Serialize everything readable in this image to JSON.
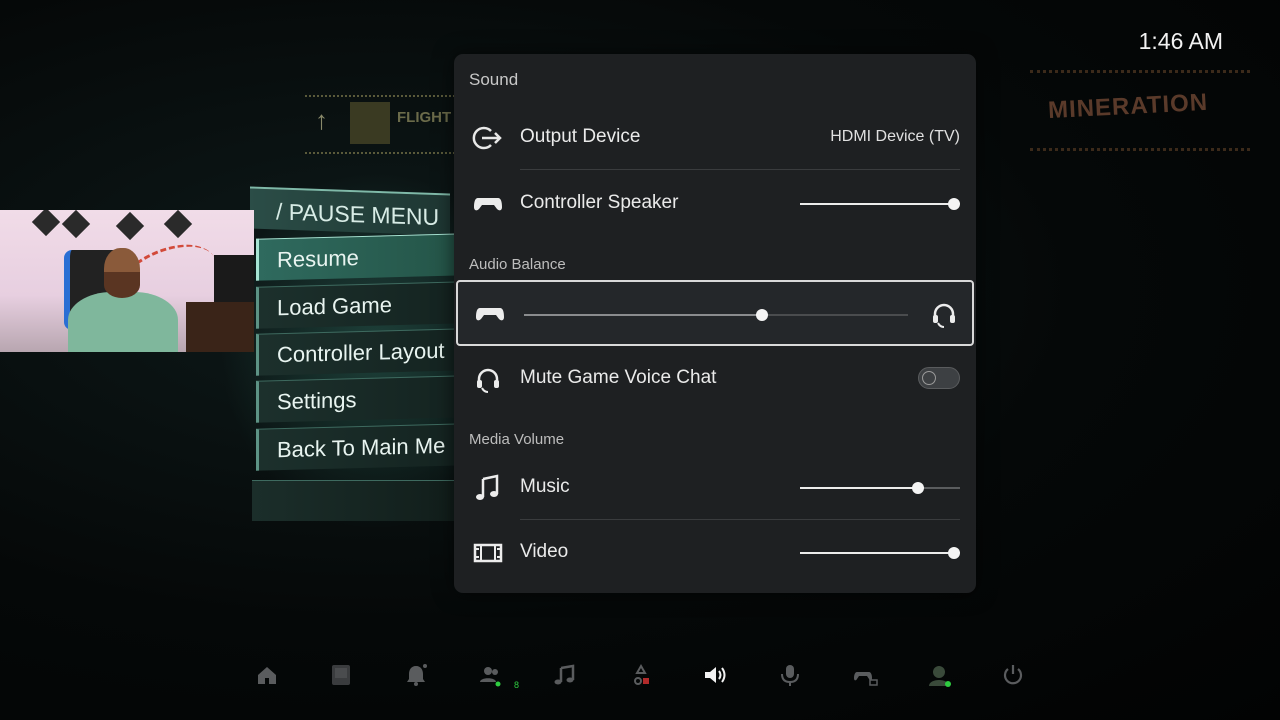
{
  "status": {
    "time": "1:46 AM"
  },
  "game_background": {
    "sign_left": "FLIGHT",
    "sign_right": "MINERATION",
    "pause_menu": {
      "title": "/ PAUSE MENU",
      "items": [
        {
          "label": "Resume",
          "selected": true
        },
        {
          "label": "Load Game",
          "selected": false
        },
        {
          "label": "Controller Layout",
          "selected": false
        },
        {
          "label": "Settings",
          "selected": false
        },
        {
          "label": "Back To Main Me",
          "selected": false
        }
      ]
    }
  },
  "sound_panel": {
    "header": "Sound",
    "output_device": {
      "label": "Output Device",
      "value": "HDMI Device (TV)",
      "icon": "output-icon"
    },
    "controller_speaker": {
      "label": "Controller Speaker",
      "level": 1.0,
      "icon": "gamepad-icon"
    },
    "audio_balance": {
      "section_title": "Audio Balance",
      "level": 0.62,
      "left_icon": "gamepad-icon",
      "right_icon": "headset-icon"
    },
    "mute_game_voice_chat": {
      "label": "Mute Game Voice Chat",
      "enabled": false,
      "icon": "headset-icon"
    },
    "media_volume": {
      "section_title": "Media Volume",
      "music": {
        "label": "Music",
        "level": 0.74,
        "icon": "music-note-icon"
      },
      "video": {
        "label": "Video",
        "level": 1.0,
        "icon": "film-icon"
      }
    }
  },
  "control_center": {
    "items": [
      {
        "name": "home-icon",
        "active": false
      },
      {
        "name": "game-icon",
        "active": false
      },
      {
        "name": "notifications-icon",
        "active": false
      },
      {
        "name": "friends-icon",
        "active": false,
        "badge": "8"
      },
      {
        "name": "music-icon",
        "active": false
      },
      {
        "name": "game-base-icon",
        "active": false
      },
      {
        "name": "sound-icon",
        "active": true
      },
      {
        "name": "mic-icon",
        "active": false
      },
      {
        "name": "accessories-icon",
        "active": false
      },
      {
        "name": "profile-icon",
        "active": false
      },
      {
        "name": "power-icon",
        "active": false
      }
    ]
  },
  "colors": {
    "panel_bg": "#1e2022",
    "accent_text": "#eaeaea",
    "online_dot": "#2ecc40"
  }
}
